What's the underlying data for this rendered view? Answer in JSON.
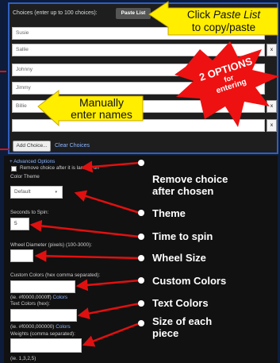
{
  "choices": {
    "header_label": "Choices (enter up to 100 choices):",
    "paste_list_label": "Paste List",
    "names": [
      "Susie",
      "Sallie",
      "Johnny",
      "Jimmy",
      "Billie",
      ""
    ],
    "remove_label": "x",
    "add_choice_label": "Add Choice...",
    "clear_choices_label": "Clear Choices"
  },
  "callouts": {
    "paste_line1_prefix": "Click ",
    "paste_line1_emphasis": "Paste List",
    "paste_line2": "to copy/paste",
    "options_line1": "2 OPTIONS",
    "options_line2": "for",
    "options_line3": "entering",
    "manual_line1": "Manually",
    "manual_line2": "enter names"
  },
  "options": {
    "advanced_toggle": "+ Advanced Options",
    "remove_after_landing_label": "Remove choice after it is landed on",
    "color_theme_label": "Color Theme",
    "color_theme_value": "Default",
    "seconds_label": "Seconds to Spin:",
    "seconds_value": "5",
    "diameter_label": "Wheel Diameter (pixels) (100-3000):",
    "diameter_value": "",
    "custom_colors_label": "Custom Colors (hex comma separated):",
    "custom_colors_hint": "(ie. #f0000,0000ff)",
    "colors_link": "Colors",
    "text_colors_label": "Text Colors (hex):",
    "text_colors_hint": "(ie. #f0000,000000)",
    "weights_label": "Weights (comma separated):",
    "weights_hint": "(ie. 1,3,2,5)"
  },
  "annotations": {
    "remove": [
      "Remove choice",
      "after chosen"
    ],
    "theme": "Theme",
    "time": "Time to spin",
    "size": "Wheel Size",
    "custom": "Custom Colors",
    "text": "Text Colors",
    "weights": [
      "Size of each",
      "piece"
    ]
  },
  "colors": {
    "callout_yellow": "#ffee00",
    "callout_red": "#ee1111",
    "arrow_red": "#e01010",
    "link_blue": "#8ab4ff"
  }
}
